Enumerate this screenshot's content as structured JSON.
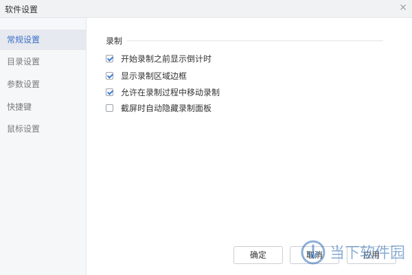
{
  "window": {
    "title": "软件设置",
    "close_glyph": "×"
  },
  "sidebar": {
    "items": [
      {
        "label": "常规设置",
        "active": true
      },
      {
        "label": "目录设置",
        "active": false
      },
      {
        "label": "参数设置",
        "active": false
      },
      {
        "label": "快捷键",
        "active": false
      },
      {
        "label": "鼠标设置",
        "active": false
      }
    ]
  },
  "main": {
    "section_title": "录制",
    "options": [
      {
        "label": "开始录制之前显示倒计时",
        "checked": true
      },
      {
        "label": "显示录制区域边框",
        "checked": true
      },
      {
        "label": "允许在录制过程中移动录制",
        "checked": true
      },
      {
        "label": "截屏时自动隐藏录制面板",
        "checked": false
      }
    ]
  },
  "footer": {
    "ok_label": "确定",
    "cancel_label": "取消",
    "apply_label": "应用"
  },
  "watermark": {
    "text": "当下软件园",
    "accent_color": "#2d6db5",
    "icon": "download-icon"
  },
  "colors": {
    "accent": "#3b6fc9",
    "check": "#3a7ad9"
  }
}
